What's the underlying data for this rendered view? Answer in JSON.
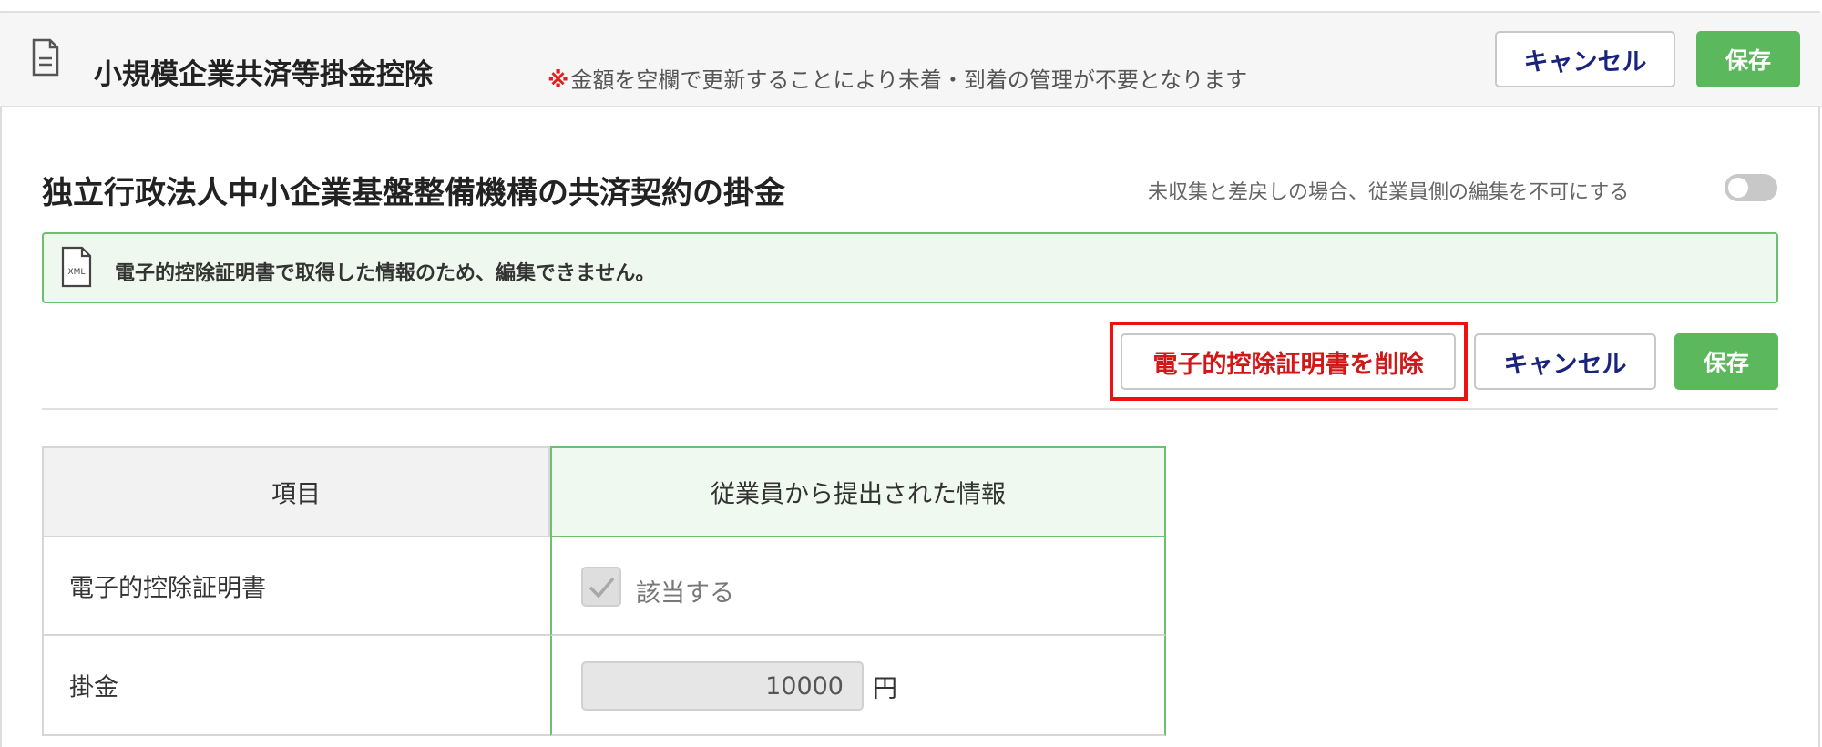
{
  "header": {
    "title": "小規模企業共済等掛金控除",
    "notice_mark": "※",
    "notice": "金額を空欄で更新することにより未着・到着の管理が不要となります",
    "cancel_label": "キャンセル",
    "save_label": "保存"
  },
  "section": {
    "title": "独立行政法人中小企業基盤整備機構の共済契約の掛金",
    "toggle_label": "未収集と差戻しの場合、従業員側の編集を不可にする",
    "toggle_on": false
  },
  "info_box": {
    "icon_text": "XML",
    "text": "電子的控除証明書で取得した情報のため、編集できません。"
  },
  "actions": {
    "delete_label": "電子的控除証明書を削除",
    "cancel_label": "キャンセル",
    "save_label": "保存"
  },
  "table": {
    "headers": [
      "項目",
      "従業員から提出された情報"
    ],
    "rows": [
      {
        "label": "電子的控除証明書",
        "checkbox_label": "該当する",
        "checked": true
      },
      {
        "label": "掛金",
        "value": "10000",
        "unit": "円"
      }
    ]
  },
  "colors": {
    "accent_green": "#5cb85c",
    "danger_red": "#d01818",
    "highlight_red": "#ee1111",
    "navy": "#1a237e"
  },
  "icons": [
    "document-icon",
    "xml-file-icon",
    "check-icon"
  ]
}
